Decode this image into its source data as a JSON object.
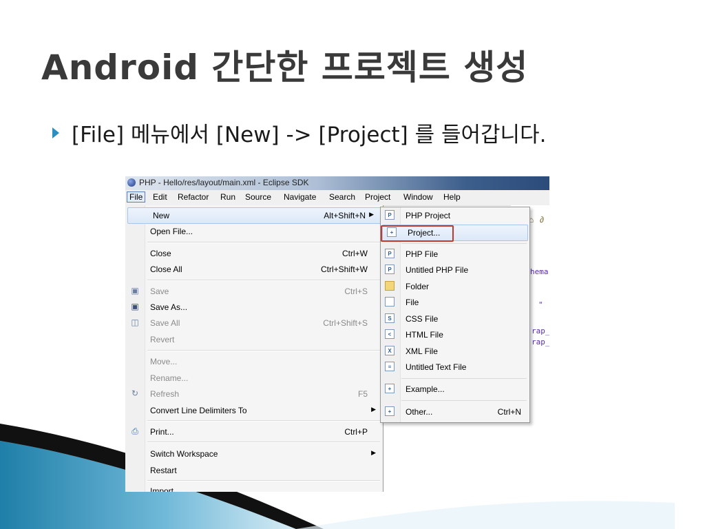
{
  "slide": {
    "title": "Android 간단한 프로젝트 생성",
    "bullet": "[File] 메뉴에서 [New] -> [Project] 를 들어갑니다."
  },
  "window": {
    "title": "PHP - Hello/res/layout/main.xml - Eclipse SDK"
  },
  "menubar": [
    "File",
    "Edit",
    "Refactor",
    "Run",
    "Source",
    "Navigate",
    "Search",
    "Project",
    "Window",
    "Help"
  ],
  "file_menu": {
    "items": [
      {
        "label": "New",
        "shortcut": "Alt+Shift+N",
        "submenu": true,
        "highlighted": true
      },
      {
        "label": "Open File..."
      },
      {
        "label": "Close",
        "shortcut": "Ctrl+W"
      },
      {
        "label": "Close All",
        "shortcut": "Ctrl+Shift+W"
      },
      {
        "label": "Save",
        "shortcut": "Ctrl+S",
        "disabled": true
      },
      {
        "label": "Save As..."
      },
      {
        "label": "Save All",
        "shortcut": "Ctrl+Shift+S",
        "disabled": true
      },
      {
        "label": "Revert",
        "disabled": true
      },
      {
        "label": "Move...",
        "disabled": true
      },
      {
        "label": "Rename...",
        "disabled": true
      },
      {
        "label": "Refresh",
        "shortcut": "F5",
        "disabled": true
      },
      {
        "label": "Convert Line Delimiters To",
        "submenu": true
      },
      {
        "label": "Print...",
        "shortcut": "Ctrl+P"
      },
      {
        "label": "Switch Workspace",
        "submenu": true
      },
      {
        "label": "Restart"
      },
      {
        "label": "Import..."
      }
    ]
  },
  "new_submenu": {
    "items": [
      {
        "label": "PHP Project",
        "icon": "php-project-icon"
      },
      {
        "label": "Project...",
        "icon": "project-icon",
        "highlighted": true
      },
      {
        "label": "PHP File",
        "icon": "php-file-icon"
      },
      {
        "label": "Untitled PHP File",
        "icon": "untitled-php-file-icon"
      },
      {
        "label": "Folder",
        "icon": "folder-icon"
      },
      {
        "label": "File",
        "icon": "file-icon"
      },
      {
        "label": "CSS File",
        "icon": "css-file-icon"
      },
      {
        "label": "HTML File",
        "icon": "html-file-icon"
      },
      {
        "label": "XML File",
        "icon": "xml-file-icon"
      },
      {
        "label": "Untitled Text File",
        "icon": "text-file-icon"
      },
      {
        "label": "Example...",
        "icon": "example-icon"
      },
      {
        "label": "Other...",
        "shortcut": "Ctrl+N",
        "icon": "other-icon"
      }
    ]
  },
  "editor_fragments": [
    "hema",
    "\"",
    "rap_",
    "rap_"
  ],
  "colors": {
    "accent": "#2a8fc0",
    "highlight_box": "#c0392b",
    "menu_highlight": "#dce8f8"
  }
}
